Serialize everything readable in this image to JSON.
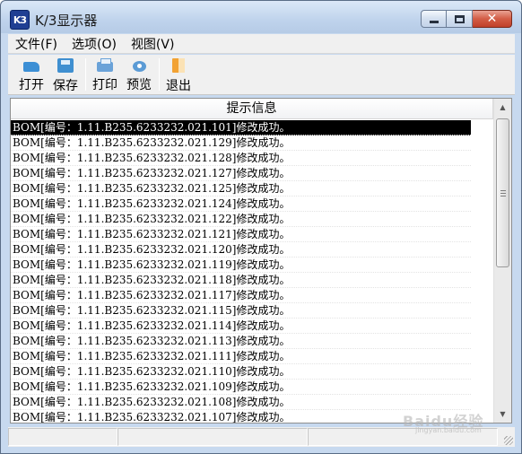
{
  "window": {
    "title": "K/3显示器",
    "icon_text": "K3",
    "close_glyph": "✕"
  },
  "menubar": [
    {
      "label": "文件(F)"
    },
    {
      "label": "选项(O)"
    },
    {
      "label": "视图(V)"
    }
  ],
  "toolbar": {
    "open_label": "打开",
    "save_label": "保存",
    "print_label": "打印",
    "preview_label": "预览",
    "exit_label": "退出"
  },
  "list": {
    "header": "提示信息",
    "selected_index": 0,
    "rows": [
      "BOM[编号：1.11.B235.6233232.021.101]修改成功。",
      "BOM[编号：1.11.B235.6233232.021.129]修改成功。",
      "BOM[编号：1.11.B235.6233232.021.128]修改成功。",
      "BOM[编号：1.11.B235.6233232.021.127]修改成功。",
      "BOM[编号：1.11.B235.6233232.021.125]修改成功。",
      "BOM[编号：1.11.B235.6233232.021.124]修改成功。",
      "BOM[编号：1.11.B235.6233232.021.122]修改成功。",
      "BOM[编号：1.11.B235.6233232.021.121]修改成功。",
      "BOM[编号：1.11.B235.6233232.021.120]修改成功。",
      "BOM[编号：1.11.B235.6233232.021.119]修改成功。",
      "BOM[编号：1.11.B235.6233232.021.118]修改成功。",
      "BOM[编号：1.11.B235.6233232.021.117]修改成功。",
      "BOM[编号：1.11.B235.6233232.021.115]修改成功。",
      "BOM[编号：1.11.B235.6233232.021.114]修改成功。",
      "BOM[编号：1.11.B235.6233232.021.113]修改成功。",
      "BOM[编号：1.11.B235.6233232.021.111]修改成功。",
      "BOM[编号：1.11.B235.6233232.021.110]修改成功。",
      "BOM[编号：1.11.B235.6233232.021.109]修改成功。",
      "BOM[编号：1.11.B235.6233232.021.108]修改成功。",
      "BOM[编号：1.11.B235.6233232.021.107]修改成功。"
    ]
  },
  "scrollbar": {
    "up_glyph": "▲",
    "down_glyph": "▼"
  },
  "watermark": {
    "text": "Baidu经验",
    "sub": "jingyan.baidu.com"
  }
}
